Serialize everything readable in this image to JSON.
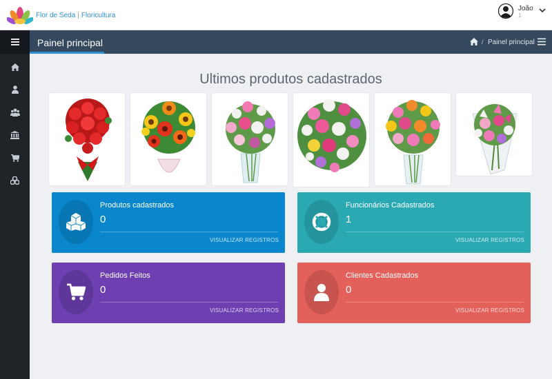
{
  "topbar": {
    "brand_name": "Flor de Seda",
    "brand_separator": "|",
    "brand_subtitle": "Floricultura",
    "user_name": "João",
    "user_count": "1",
    "logo_icon": "lotus-logo",
    "caret_icon": "chevron-down-icon"
  },
  "sidebar": {
    "toggle_icon": "hamburger-icon",
    "items": [
      {
        "icon": "home-icon"
      },
      {
        "icon": "user-icon"
      },
      {
        "icon": "users-icon"
      },
      {
        "icon": "bank-icon"
      },
      {
        "icon": "cart-icon"
      },
      {
        "icon": "cubes-icon"
      }
    ]
  },
  "header": {
    "title": "Painel principal",
    "breadcrumb_separator": "/",
    "breadcrumb_current": "Painel principal"
  },
  "products": {
    "title": "Ultimos produtos cadastrados",
    "items": [
      {
        "image": "red-rose-bouquet"
      },
      {
        "image": "sunflower-gerbera-bouquet"
      },
      {
        "image": "alstroemeria-vase-bouquet"
      },
      {
        "image": "mixed-rose-daisy-bouquet"
      },
      {
        "image": "pink-orange-vase-bouquet"
      },
      {
        "image": "lily-wrapped-bouquet"
      }
    ]
  },
  "stats": [
    {
      "label": "Produtos cadastrados",
      "value": "0",
      "link": "VISUALIZAR REGISTROS",
      "color": "#0a87cc",
      "icon": "cubes-icon"
    },
    {
      "label": "Funcionários Cadastrados",
      "value": "1",
      "link": "VISUALIZAR REGISTROS",
      "color": "#2aa9b3",
      "icon": "lifebuoy-icon"
    },
    {
      "label": "Pedidos Feitos",
      "value": "0",
      "link": "VISUALIZAR REGISTROS",
      "color": "#6d3fb0",
      "icon": "cart-icon"
    },
    {
      "label": "Clientes Cadastrados",
      "value": "0",
      "link": "VISUALIZAR REGISTROS",
      "color": "#e4605a",
      "icon": "user-icon"
    }
  ],
  "colors": {
    "sidebar": "#1f2429",
    "header": "#34495e",
    "accent": "#2f8fd0",
    "background": "#eef0f4"
  }
}
